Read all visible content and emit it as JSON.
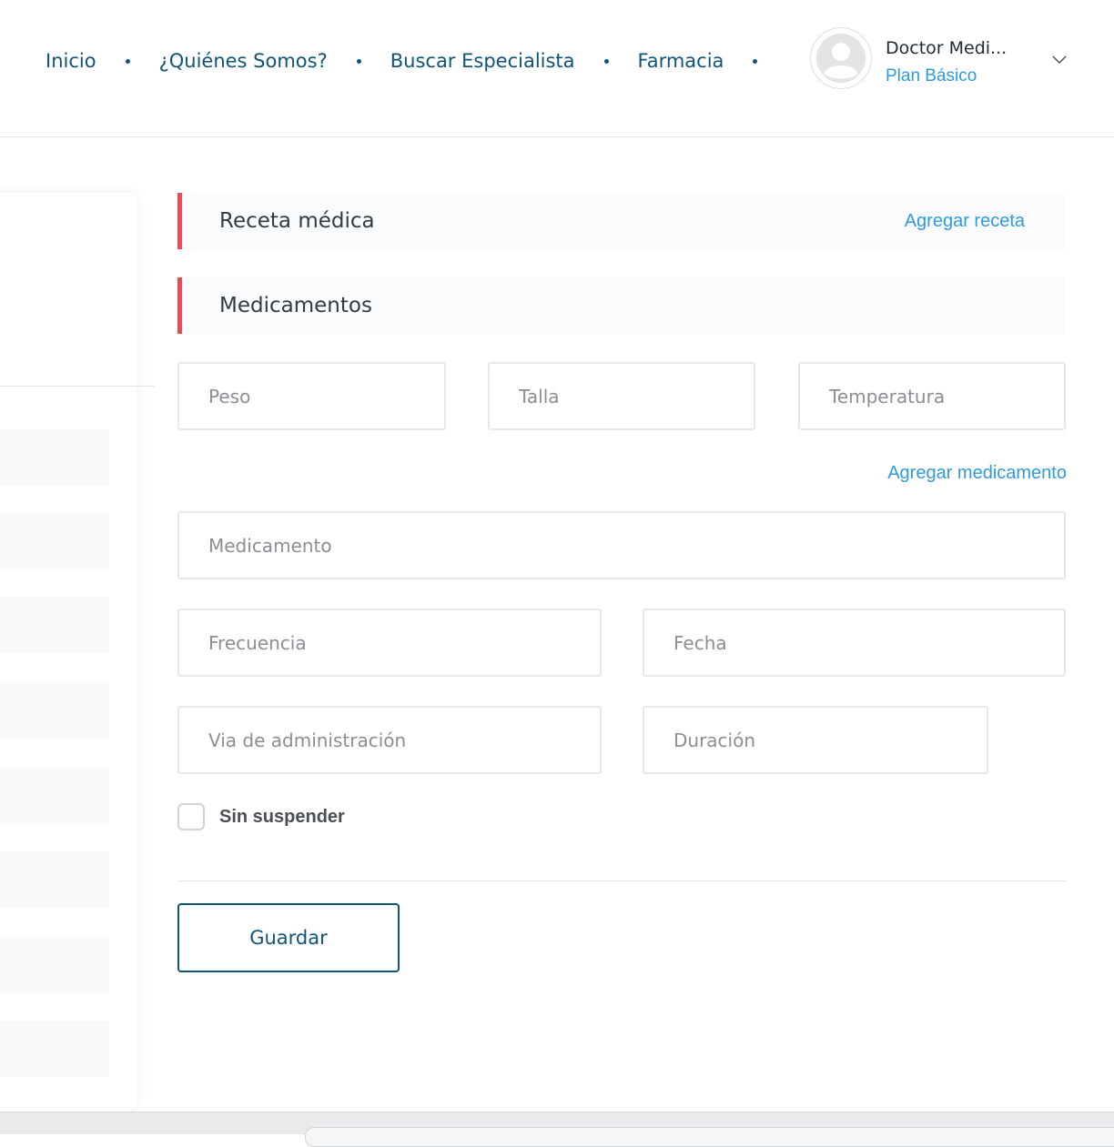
{
  "nav": {
    "items": [
      {
        "label": "Inicio"
      },
      {
        "label": "¿Quiénes Somos?"
      },
      {
        "label": "Buscar Especialista"
      },
      {
        "label": "Farmacia"
      }
    ]
  },
  "user": {
    "name": "Doctor Medi...",
    "plan": "Plan Básico"
  },
  "prescription": {
    "title": "Receta médica",
    "add_label": "Agregar receta"
  },
  "medications": {
    "title": "Medicamentos",
    "add_label": "Agregar medicamento"
  },
  "form": {
    "peso_placeholder": "Peso",
    "talla_placeholder": "Talla",
    "temperatura_placeholder": "Temperatura",
    "medicamento_placeholder": "Medicamento",
    "frecuencia_placeholder": "Frecuencia",
    "fecha_placeholder": "Fecha",
    "via_placeholder": "Via de administración",
    "duracion_placeholder": "Duración",
    "sin_suspender_label": "Sin suspender",
    "save_label": "Guardar"
  },
  "colors": {
    "primary": "#0e5577",
    "link": "#2f9bdc",
    "accent_bar": "#ee4a55"
  }
}
